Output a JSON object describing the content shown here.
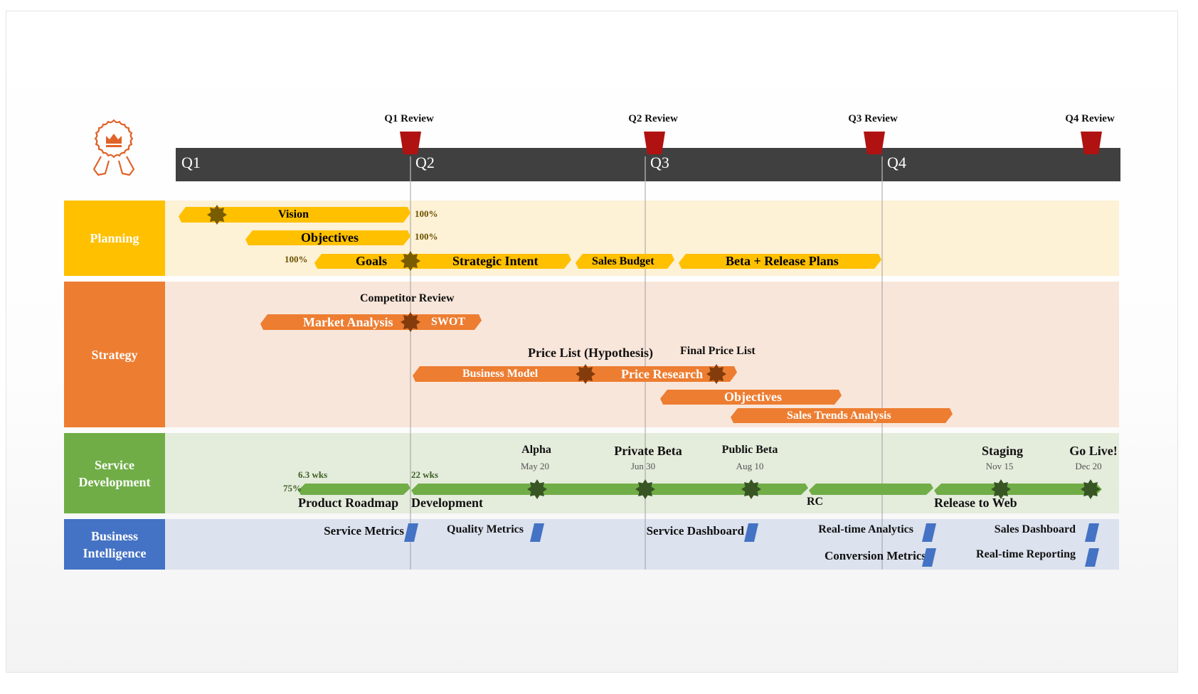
{
  "colors": {
    "header_bar": "#404040",
    "review_flag": "#b01212",
    "badge": "#e0632a",
    "planning": "#ffc000",
    "planning_bg": "#fdf1d6",
    "planning_star": "#7a5c00",
    "strategy": "#ed7d31",
    "strategy_bg": "#f9e6da",
    "strategy_star": "#843c0c",
    "service": "#70ad47",
    "service_bg": "#e4ecdc",
    "service_star": "#375623",
    "bi": "#4472c4",
    "bi_bg": "#dce2ee"
  },
  "badge_icon": "award-crown-icon",
  "quarters": [
    "Q1",
    "Q2",
    "Q3",
    "Q4"
  ],
  "reviews": [
    "Q1 Review",
    "Q2 Review",
    "Q3 Review",
    "Q4 Review"
  ],
  "lanes": {
    "planning": {
      "label": "Planning",
      "bars": [
        {
          "labels": [
            "Vision"
          ],
          "percent": "100%"
        },
        {
          "labels": [
            "Objectives"
          ],
          "percent": "100%"
        },
        {
          "labels": [
            "Goals",
            "Strategic Intent"
          ],
          "percent": "100%"
        },
        {
          "labels": [
            "Sales Budget"
          ]
        },
        {
          "labels": [
            "Beta + Release Plans"
          ]
        }
      ]
    },
    "strategy": {
      "label": "Strategy",
      "milestones": [
        "Competitor Review",
        "Price List (Hypothesis)",
        "Final Price List"
      ],
      "bars": [
        {
          "labels": [
            "Market Analysis",
            "SWOT"
          ]
        },
        {
          "labels": [
            "Business Model",
            "Price Research"
          ]
        },
        {
          "labels": [
            "Objectives"
          ]
        },
        {
          "labels": [
            "Sales Trends Analysis"
          ]
        }
      ]
    },
    "service": {
      "label": "Service Development",
      "percent": "75%",
      "durations": [
        "6.3 wks",
        "22 wks"
      ],
      "tasks": [
        "Product Roadmap",
        "Development",
        "RC",
        "Release to Web"
      ],
      "milestones": [
        {
          "name": "Alpha",
          "date": "May 20"
        },
        {
          "name": "Private Beta",
          "date": "Jun 30"
        },
        {
          "name": "Public Beta",
          "date": "Aug 10"
        },
        {
          "name": "Staging",
          "date": "Nov 15"
        },
        {
          "name": "Go Live!",
          "date": "Dec 20"
        }
      ]
    },
    "bi": {
      "label": "Business Intelligence",
      "items": [
        "Service Metrics",
        "Quality Metrics",
        "Service Dashboard",
        "Real-time Analytics",
        "Sales Dashboard",
        "Conversion Metrics",
        "Real-time Reporting"
      ]
    }
  }
}
